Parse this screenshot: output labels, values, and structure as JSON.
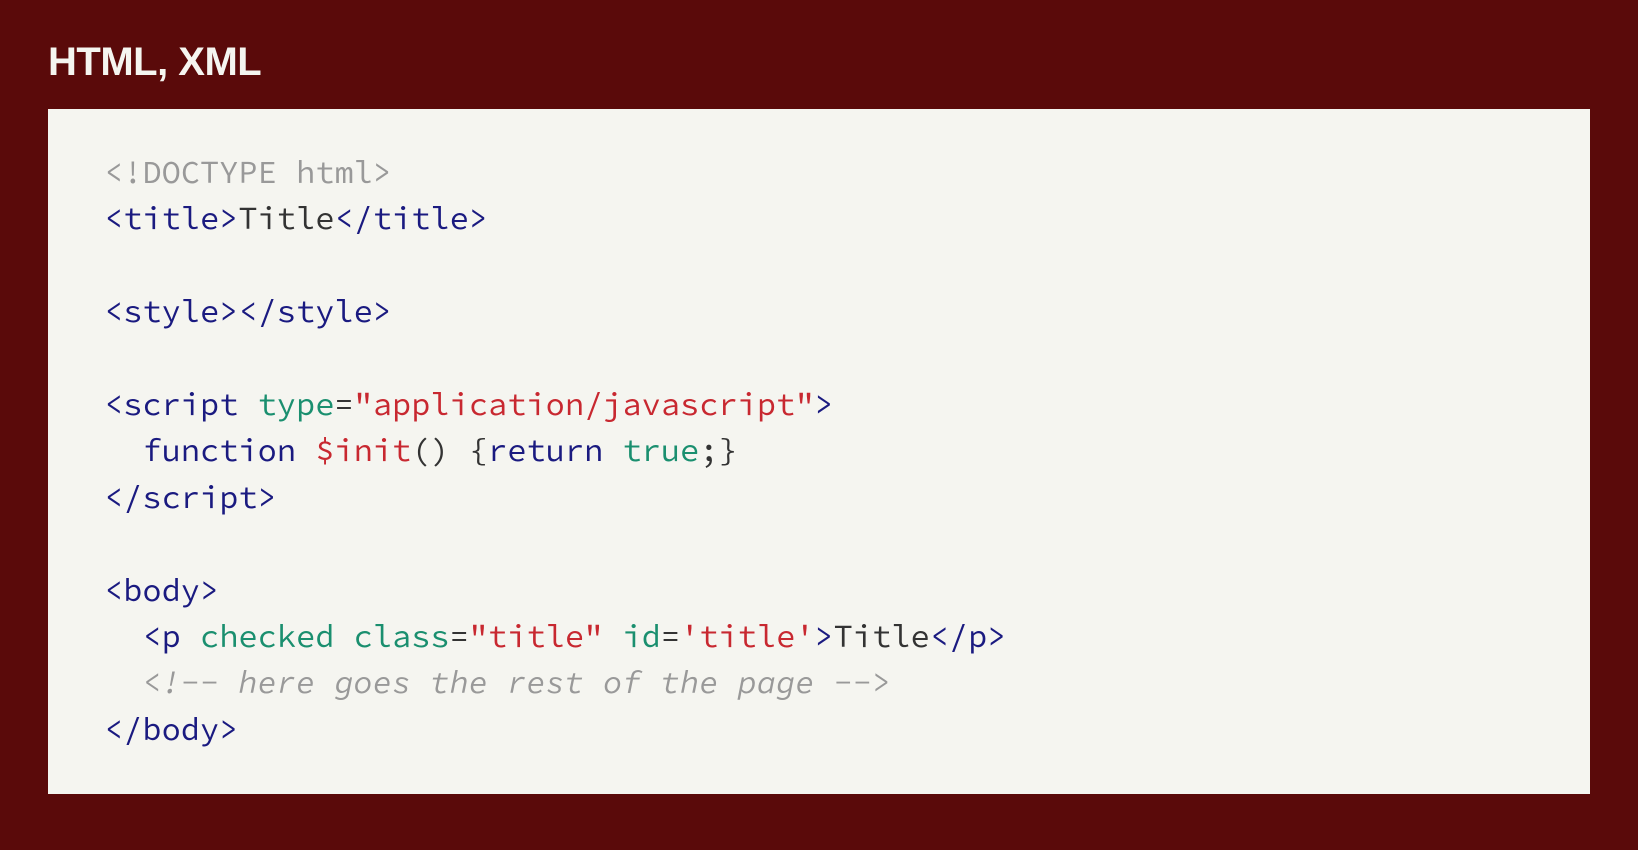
{
  "heading": "HTML, XML",
  "code": {
    "tokens": [
      [
        {
          "t": "<!DOCTYPE html>",
          "c": "tok-doctype"
        }
      ],
      [
        {
          "t": "<title>",
          "c": "tok-tag"
        },
        {
          "t": "Title",
          "c": "tok-text"
        },
        {
          "t": "</title>",
          "c": "tok-tag"
        }
      ],
      [],
      [
        {
          "t": "<style>",
          "c": "tok-tag"
        },
        {
          "t": "</style>",
          "c": "tok-tag"
        }
      ],
      [],
      [
        {
          "t": "<script ",
          "c": "tok-tag"
        },
        {
          "t": "type",
          "c": "tok-attr"
        },
        {
          "t": "=",
          "c": "tok-text"
        },
        {
          "t": "\"application/javascript\"",
          "c": "tok-string"
        },
        {
          "t": ">",
          "c": "tok-tag"
        }
      ],
      [
        {
          "t": "  ",
          "c": "tok-text"
        },
        {
          "t": "function",
          "c": "tok-keyword"
        },
        {
          "t": " ",
          "c": "tok-text"
        },
        {
          "t": "$init",
          "c": "tok-funcname"
        },
        {
          "t": "() {",
          "c": "tok-text"
        },
        {
          "t": "return",
          "c": "tok-keyword"
        },
        {
          "t": " ",
          "c": "tok-text"
        },
        {
          "t": "true",
          "c": "tok-literal"
        },
        {
          "t": ";}",
          "c": "tok-text"
        }
      ],
      [
        {
          "t": "</script>",
          "c": "tok-tag"
        }
      ],
      [],
      [
        {
          "t": "<body>",
          "c": "tok-tag"
        }
      ],
      [
        {
          "t": "  ",
          "c": "tok-text"
        },
        {
          "t": "<p ",
          "c": "tok-tag"
        },
        {
          "t": "checked",
          "c": "tok-attr"
        },
        {
          "t": " ",
          "c": "tok-text"
        },
        {
          "t": "class",
          "c": "tok-attr"
        },
        {
          "t": "=",
          "c": "tok-text"
        },
        {
          "t": "\"title\"",
          "c": "tok-string"
        },
        {
          "t": " ",
          "c": "tok-text"
        },
        {
          "t": "id",
          "c": "tok-attr"
        },
        {
          "t": "=",
          "c": "tok-text"
        },
        {
          "t": "'title'",
          "c": "tok-string"
        },
        {
          "t": ">",
          "c": "tok-tag"
        },
        {
          "t": "Title",
          "c": "tok-text"
        },
        {
          "t": "</p>",
          "c": "tok-tag"
        }
      ],
      [
        {
          "t": "  ",
          "c": "tok-text"
        },
        {
          "t": "<!-- here goes the rest of the page -->",
          "c": "tok-italic"
        }
      ],
      [
        {
          "t": "</body>",
          "c": "tok-tag"
        }
      ]
    ]
  }
}
